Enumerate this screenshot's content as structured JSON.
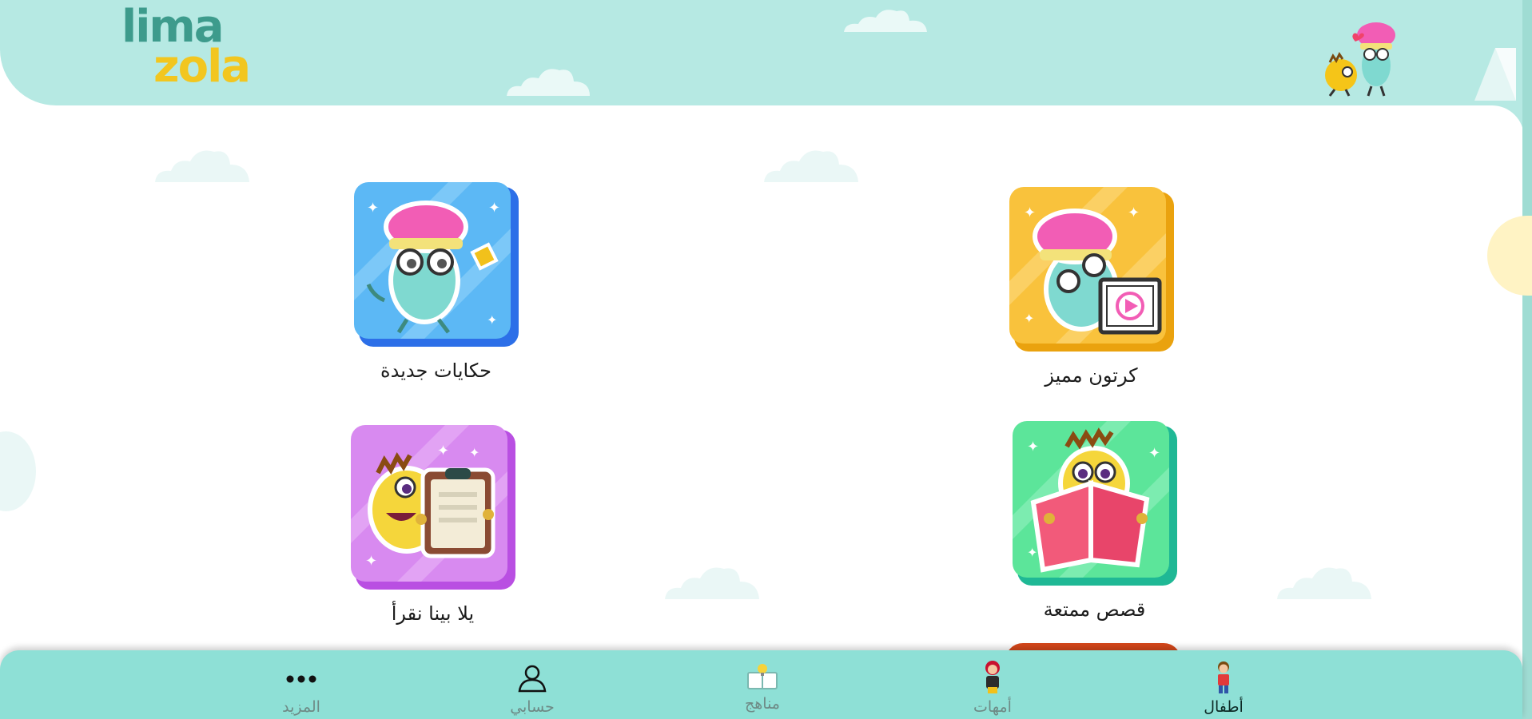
{
  "brand": {
    "logo_top": "lima",
    "logo_bottom": "zola"
  },
  "tiles": [
    {
      "label": "حكايات جديدة",
      "icon": "brain-character-pencil-icon",
      "bg": "#5cb8f5",
      "shadow": "#2c6fe8"
    },
    {
      "label": "كرتون مميز",
      "icon": "brain-character-video-icon",
      "bg": "#f9c23c",
      "shadow": "#eaa20e"
    },
    {
      "label": "يلا بينا نقرأ",
      "icon": "character-clipboard-icon",
      "bg": "#d88af0",
      "shadow": "#b94fe2"
    },
    {
      "label": "قصص ممتعة",
      "icon": "character-book-icon",
      "bg": "#5ce59a",
      "shadow": "#1fb895"
    }
  ],
  "bottom_nav": {
    "items": [
      {
        "label": "المزيد",
        "icon": "more-dots-icon",
        "state": "dim"
      },
      {
        "label": "حسابي",
        "icon": "user-account-icon",
        "state": "dim"
      },
      {
        "label": "مناهج",
        "icon": "curriculum-book-icon",
        "state": "dim"
      },
      {
        "label": "أمهات",
        "icon": "mothers-icon",
        "state": "dim"
      },
      {
        "label": "أطفال",
        "icon": "kids-icon",
        "state": "active"
      }
    ]
  },
  "colors": {
    "header_bg": "#b6e9e3",
    "nav_bg": "#8ee0d6",
    "logo_teal": "#3d9b8c",
    "logo_yellow": "#f2c61f"
  }
}
